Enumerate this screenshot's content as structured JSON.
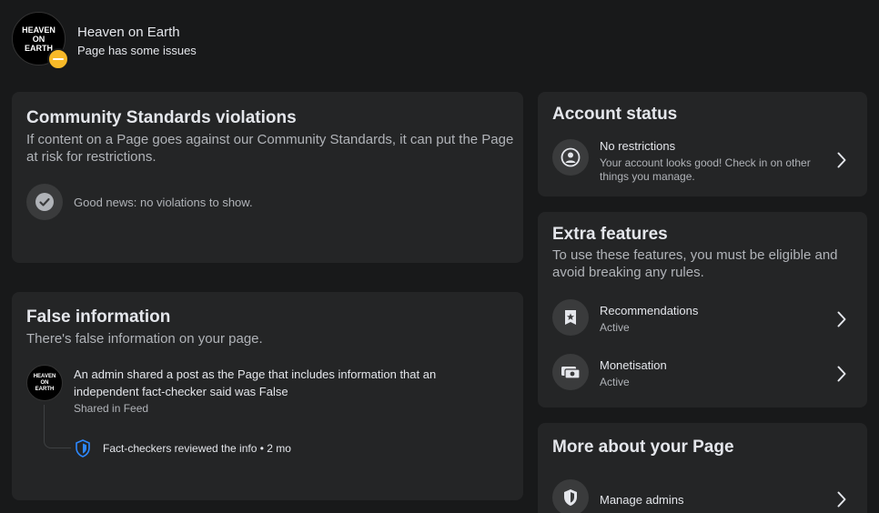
{
  "header": {
    "avatar_lines": [
      "HEAVEN",
      "ON",
      "EARTH"
    ],
    "page_name": "Heaven on Earth",
    "status": "Page has some issues"
  },
  "violations": {
    "title": "Community Standards violations",
    "description": "If content on a Page goes against our Community Standards, it can put the Page at risk for restrictions.",
    "good_news": "Good news: no violations to show."
  },
  "false_info": {
    "title": "False information",
    "description": "There's false information on your page.",
    "post_text": "An admin shared a post as the Page that includes information that an independent fact-checker said was False",
    "post_meta": "Shared in Feed",
    "review_text": "Fact-checkers reviewed the info • 2 mo"
  },
  "account_status": {
    "title": "Account status",
    "item_title": "No restrictions",
    "item_sub": "Your account looks good! Check in on other things you manage."
  },
  "extra_features": {
    "title": "Extra features",
    "description": "To use these features, you must be eligible and avoid breaking any rules.",
    "items": [
      {
        "label": "Recommendations",
        "status": "Active"
      },
      {
        "label": "Monetisation",
        "status": "Active"
      }
    ]
  },
  "more_about": {
    "title": "More about your Page",
    "items": [
      {
        "label": "Manage admins"
      }
    ]
  },
  "colors": {
    "background": "#18191a",
    "card": "#242526",
    "icon_bg": "#3a3b3c",
    "warning": "#f7b928",
    "shield_blue": "#2d88ff"
  }
}
